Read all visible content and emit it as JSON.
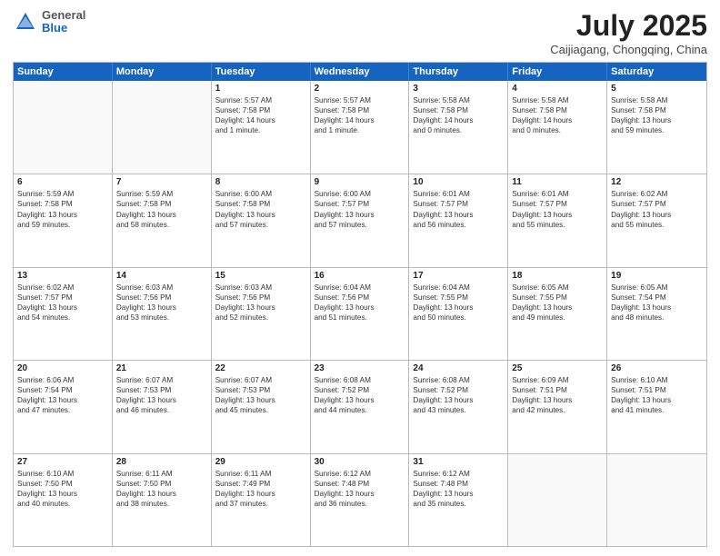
{
  "header": {
    "logo": {
      "general": "General",
      "blue": "Blue"
    },
    "title": "July 2025",
    "location": "Caijiagang, Chongqing, China"
  },
  "days_of_week": [
    "Sunday",
    "Monday",
    "Tuesday",
    "Wednesday",
    "Thursday",
    "Friday",
    "Saturday"
  ],
  "weeks": [
    [
      {
        "day": "",
        "empty": true
      },
      {
        "day": "",
        "empty": true
      },
      {
        "day": "1",
        "lines": [
          "Sunrise: 5:57 AM",
          "Sunset: 7:58 PM",
          "Daylight: 14 hours",
          "and 1 minute."
        ]
      },
      {
        "day": "2",
        "lines": [
          "Sunrise: 5:57 AM",
          "Sunset: 7:58 PM",
          "Daylight: 14 hours",
          "and 1 minute."
        ]
      },
      {
        "day": "3",
        "lines": [
          "Sunrise: 5:58 AM",
          "Sunset: 7:58 PM",
          "Daylight: 14 hours",
          "and 0 minutes."
        ]
      },
      {
        "day": "4",
        "lines": [
          "Sunrise: 5:58 AM",
          "Sunset: 7:58 PM",
          "Daylight: 14 hours",
          "and 0 minutes."
        ]
      },
      {
        "day": "5",
        "lines": [
          "Sunrise: 5:58 AM",
          "Sunset: 7:58 PM",
          "Daylight: 13 hours",
          "and 59 minutes."
        ]
      }
    ],
    [
      {
        "day": "6",
        "lines": [
          "Sunrise: 5:59 AM",
          "Sunset: 7:58 PM",
          "Daylight: 13 hours",
          "and 59 minutes."
        ]
      },
      {
        "day": "7",
        "lines": [
          "Sunrise: 5:59 AM",
          "Sunset: 7:58 PM",
          "Daylight: 13 hours",
          "and 58 minutes."
        ]
      },
      {
        "day": "8",
        "lines": [
          "Sunrise: 6:00 AM",
          "Sunset: 7:58 PM",
          "Daylight: 13 hours",
          "and 57 minutes."
        ]
      },
      {
        "day": "9",
        "lines": [
          "Sunrise: 6:00 AM",
          "Sunset: 7:57 PM",
          "Daylight: 13 hours",
          "and 57 minutes."
        ]
      },
      {
        "day": "10",
        "lines": [
          "Sunrise: 6:01 AM",
          "Sunset: 7:57 PM",
          "Daylight: 13 hours",
          "and 56 minutes."
        ]
      },
      {
        "day": "11",
        "lines": [
          "Sunrise: 6:01 AM",
          "Sunset: 7:57 PM",
          "Daylight: 13 hours",
          "and 55 minutes."
        ]
      },
      {
        "day": "12",
        "lines": [
          "Sunrise: 6:02 AM",
          "Sunset: 7:57 PM",
          "Daylight: 13 hours",
          "and 55 minutes."
        ]
      }
    ],
    [
      {
        "day": "13",
        "lines": [
          "Sunrise: 6:02 AM",
          "Sunset: 7:57 PM",
          "Daylight: 13 hours",
          "and 54 minutes."
        ]
      },
      {
        "day": "14",
        "lines": [
          "Sunrise: 6:03 AM",
          "Sunset: 7:56 PM",
          "Daylight: 13 hours",
          "and 53 minutes."
        ]
      },
      {
        "day": "15",
        "lines": [
          "Sunrise: 6:03 AM",
          "Sunset: 7:56 PM",
          "Daylight: 13 hours",
          "and 52 minutes."
        ]
      },
      {
        "day": "16",
        "lines": [
          "Sunrise: 6:04 AM",
          "Sunset: 7:56 PM",
          "Daylight: 13 hours",
          "and 51 minutes."
        ]
      },
      {
        "day": "17",
        "lines": [
          "Sunrise: 6:04 AM",
          "Sunset: 7:55 PM",
          "Daylight: 13 hours",
          "and 50 minutes."
        ]
      },
      {
        "day": "18",
        "lines": [
          "Sunrise: 6:05 AM",
          "Sunset: 7:55 PM",
          "Daylight: 13 hours",
          "and 49 minutes."
        ]
      },
      {
        "day": "19",
        "lines": [
          "Sunrise: 6:05 AM",
          "Sunset: 7:54 PM",
          "Daylight: 13 hours",
          "and 48 minutes."
        ]
      }
    ],
    [
      {
        "day": "20",
        "lines": [
          "Sunrise: 6:06 AM",
          "Sunset: 7:54 PM",
          "Daylight: 13 hours",
          "and 47 minutes."
        ]
      },
      {
        "day": "21",
        "lines": [
          "Sunrise: 6:07 AM",
          "Sunset: 7:53 PM",
          "Daylight: 13 hours",
          "and 46 minutes."
        ]
      },
      {
        "day": "22",
        "lines": [
          "Sunrise: 6:07 AM",
          "Sunset: 7:53 PM",
          "Daylight: 13 hours",
          "and 45 minutes."
        ]
      },
      {
        "day": "23",
        "lines": [
          "Sunrise: 6:08 AM",
          "Sunset: 7:52 PM",
          "Daylight: 13 hours",
          "and 44 minutes."
        ]
      },
      {
        "day": "24",
        "lines": [
          "Sunrise: 6:08 AM",
          "Sunset: 7:52 PM",
          "Daylight: 13 hours",
          "and 43 minutes."
        ]
      },
      {
        "day": "25",
        "lines": [
          "Sunrise: 6:09 AM",
          "Sunset: 7:51 PM",
          "Daylight: 13 hours",
          "and 42 minutes."
        ]
      },
      {
        "day": "26",
        "lines": [
          "Sunrise: 6:10 AM",
          "Sunset: 7:51 PM",
          "Daylight: 13 hours",
          "and 41 minutes."
        ]
      }
    ],
    [
      {
        "day": "27",
        "lines": [
          "Sunrise: 6:10 AM",
          "Sunset: 7:50 PM",
          "Daylight: 13 hours",
          "and 40 minutes."
        ]
      },
      {
        "day": "28",
        "lines": [
          "Sunrise: 6:11 AM",
          "Sunset: 7:50 PM",
          "Daylight: 13 hours",
          "and 38 minutes."
        ]
      },
      {
        "day": "29",
        "lines": [
          "Sunrise: 6:11 AM",
          "Sunset: 7:49 PM",
          "Daylight: 13 hours",
          "and 37 minutes."
        ]
      },
      {
        "day": "30",
        "lines": [
          "Sunrise: 6:12 AM",
          "Sunset: 7:48 PM",
          "Daylight: 13 hours",
          "and 36 minutes."
        ]
      },
      {
        "day": "31",
        "lines": [
          "Sunrise: 6:12 AM",
          "Sunset: 7:48 PM",
          "Daylight: 13 hours",
          "and 35 minutes."
        ]
      },
      {
        "day": "",
        "empty": true
      },
      {
        "day": "",
        "empty": true
      }
    ]
  ]
}
